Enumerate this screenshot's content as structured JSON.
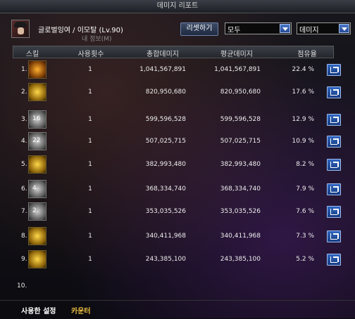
{
  "window": {
    "title": "데미지 리포트"
  },
  "header": {
    "character": "글로벌잉여 / 이모탈 (Lv.90)",
    "subtitle": "내 정보(M)",
    "reset_label": "리셋하기",
    "filter1": "모두",
    "filter2": "데미지"
  },
  "columns": {
    "skill": "스킬",
    "uses": "사용횟수",
    "total": "총합데미지",
    "avg": "평균데미지",
    "share": "점유율"
  },
  "rows": [
    {
      "rank": "1.",
      "badge": "",
      "uses": "1",
      "total": "1,041,567,891",
      "avg": "1,041,567,891",
      "share": "22.4 %",
      "icon": "flame-burst-icon"
    },
    {
      "rank": "2.",
      "badge": "",
      "uses": "1",
      "total": "820,950,680",
      "avg": "820,950,680",
      "share": "17.6 %",
      "icon": "skull-crossbones-icon"
    },
    {
      "rank": "3.",
      "badge": "16",
      "uses": "1",
      "total": "599,596,528",
      "avg": "599,596,528",
      "share": "12.9 %",
      "icon": "shadow-strike-icon"
    },
    {
      "rank": "4.",
      "badge": "22",
      "uses": "1",
      "total": "507,025,715",
      "avg": "507,025,715",
      "share": "10.9 %",
      "icon": "dark-slash-icon"
    },
    {
      "rank": "5.",
      "badge": "",
      "uses": "1",
      "total": "382,993,480",
      "avg": "382,993,480",
      "share": "8.2 %",
      "icon": "golden-vortex-icon"
    },
    {
      "rank": "6.",
      "badge": "4",
      "uses": "1",
      "total": "368,334,740",
      "avg": "368,334,740",
      "share": "7.9 %",
      "icon": "blade-cross-icon"
    },
    {
      "rank": "7.",
      "badge": "2",
      "uses": "1",
      "total": "353,035,526",
      "avg": "353,035,526",
      "share": "7.6 %",
      "icon": "void-hand-icon"
    },
    {
      "rank": "8.",
      "badge": "",
      "uses": "1",
      "total": "340,411,968",
      "avg": "340,411,968",
      "share": "7.3 %",
      "icon": "sun-ring-icon"
    },
    {
      "rank": "9.",
      "badge": "",
      "uses": "1",
      "total": "243,385,100",
      "avg": "243,385,100",
      "share": "5.2 %",
      "icon": "crescent-flame-icon"
    },
    {
      "rank": "10.",
      "badge": "",
      "uses": "",
      "total": "",
      "avg": "",
      "share": "",
      "icon": ""
    }
  ],
  "footer": {
    "tab_settings": "사용한 설정",
    "tab_counter": "카운터"
  }
}
